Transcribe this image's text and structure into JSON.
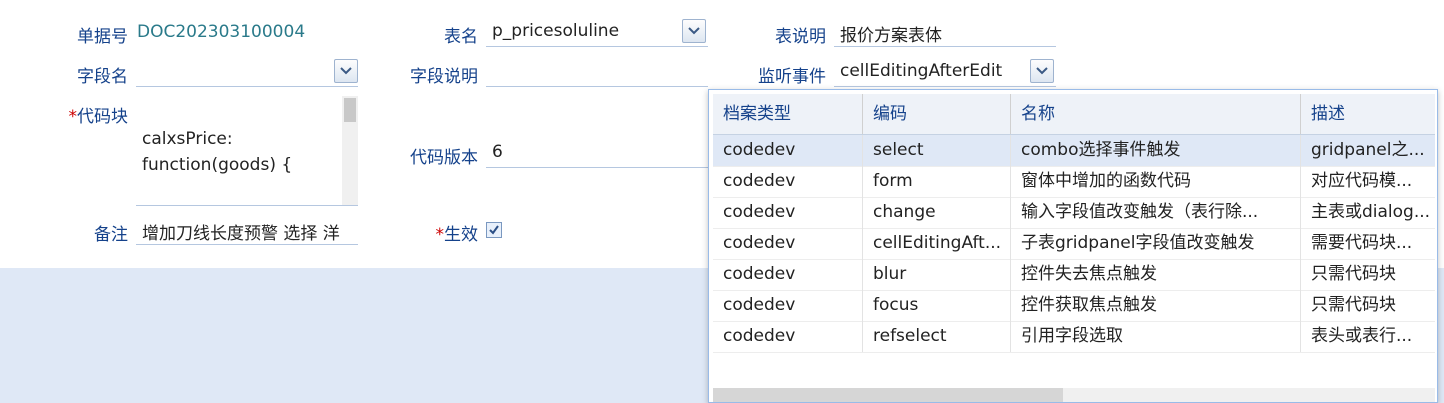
{
  "form": {
    "doc_no": {
      "label": "单据号",
      "value": "DOC202303100004"
    },
    "table_name": {
      "label": "表名",
      "value": "p_pricesoluline"
    },
    "table_desc": {
      "label": "表说明",
      "value": "报价方案表体"
    },
    "field_name": {
      "label": "字段名",
      "value": ""
    },
    "field_desc": {
      "label": "字段说明",
      "value": ""
    },
    "listen_event": {
      "label": "监听事件",
      "value": "cellEditingAfterEdit"
    },
    "code_block": {
      "required_mark": "*",
      "label": "代码块",
      "value": "calxsPrice:\nfunction(goods) {"
    },
    "code_version": {
      "label": "代码版本",
      "value": "6"
    },
    "remark": {
      "label": "备注",
      "value": "增加刀线长度预警 选择 洋"
    },
    "active": {
      "required_mark": "*",
      "label": "生效",
      "checked": true
    }
  },
  "dropdown": {
    "columns": [
      "档案类型",
      "编码",
      "名称",
      "描述"
    ],
    "selected_index": 0,
    "rows": [
      [
        "codedev",
        "select",
        "combo选择事件触发",
        "gridpanel之..."
      ],
      [
        "codedev",
        "form",
        "窗体中增加的函数代码",
        "对应代码模..."
      ],
      [
        "codedev",
        "change",
        "输入字段值改变触发（表行除...",
        "主表或dialog..."
      ],
      [
        "codedev",
        "cellEditingAft...",
        "子表gridpanel字段值改变触发",
        "需要代码块..."
      ],
      [
        "codedev",
        "blur",
        "控件失去焦点触发",
        "只需代码块"
      ],
      [
        "codedev",
        "focus",
        "控件获取焦点触发",
        "只需代码块"
      ],
      [
        "codedev",
        "refselect",
        "引用字段选取",
        "表头或表行..."
      ]
    ]
  },
  "colors": {
    "label": "#15428b",
    "doc_no": "#2a7a8a",
    "required": "#cc0000",
    "selected_row": "#dfe8f6",
    "background_band": "#dfe8f6"
  },
  "icons": [
    "chevron-down-icon",
    "checkmark-icon"
  ]
}
